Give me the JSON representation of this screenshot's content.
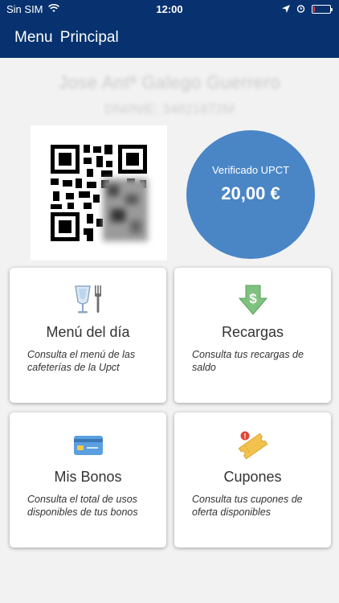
{
  "status": {
    "carrier": "Sin SIM",
    "time": "12:00",
    "battery_percent": 10,
    "colors": {
      "bar": "#07326f",
      "battery_low": "#e23a3a"
    }
  },
  "navbar": {
    "title": "Menu  Principal"
  },
  "user": {
    "name": "Jose Antª Galego Guerrero",
    "dni": "DNI/NIE: 34821872M"
  },
  "balance": {
    "label": "Verificado UPCT",
    "value": "20,00 €",
    "color": "#4a86c6"
  },
  "cards": [
    {
      "icon": "glass-and-fork-icon",
      "title": "Menú del día",
      "description": "Consulta el menú de las cafeterías de la Upct"
    },
    {
      "icon": "dollar-arrow-down-icon",
      "title": "Recargas",
      "description": "Consulta tus recargas de saldo"
    },
    {
      "icon": "credit-card-icon",
      "title": "Mis Bonos",
      "description": "Consulta el total de usos disponibles de tus bonos"
    },
    {
      "icon": "ticket-coupon-icon",
      "title": "Cupones",
      "description": "Consulta tus cupones de oferta disponibles"
    }
  ]
}
